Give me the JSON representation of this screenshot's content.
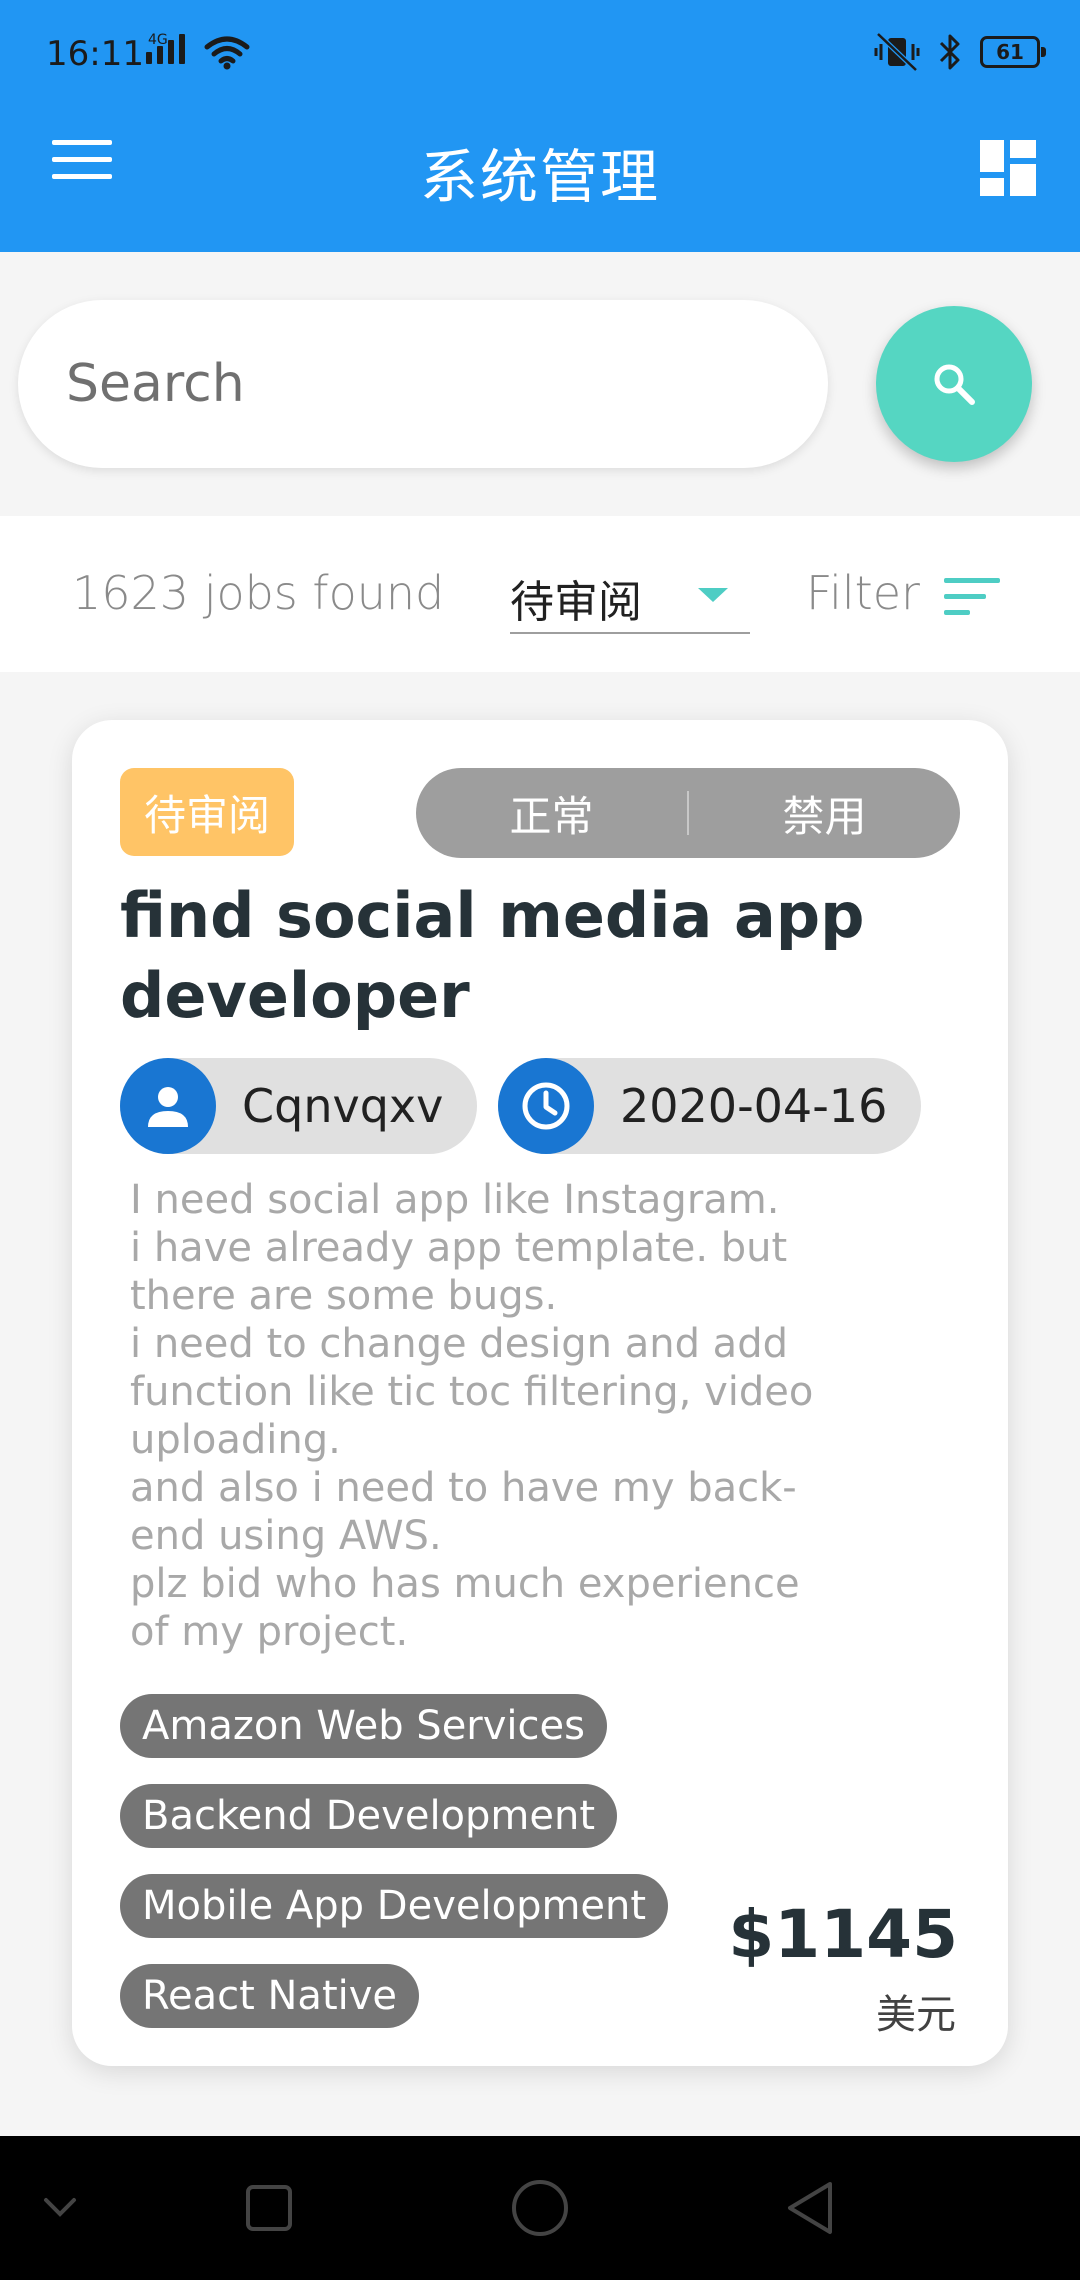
{
  "status_bar": {
    "time": "16:11",
    "network_label": "4G",
    "battery": "61"
  },
  "app_bar": {
    "title": "系统管理",
    "menu_icon": "hamburger-menu-icon",
    "dashboard_icon": "dashboard-icon"
  },
  "search": {
    "placeholder": "Search"
  },
  "filter_bar": {
    "jobs_count": "1623 jobs found",
    "status_selected": "待审阅",
    "filter_label": "Filter"
  },
  "job_card": {
    "status_badge": "待审阅",
    "toggle_options": [
      "正常",
      "禁用"
    ],
    "title": "find social media app developer",
    "author": "Cqnvqxv",
    "date": "2020-04-16",
    "description": "I need social app like Instagram.\ni have already app template. but\nthere are some bugs.\ni need to change design and add\nfunction like tic toc filtering, video\nuploading.\nand also i need to have my back-\nend using AWS.\nplz bid  who has much experience\nof my project.",
    "tags": [
      "Amazon Web Services",
      "Backend Development",
      "Mobile App Development",
      "React Native"
    ],
    "price": "$1145",
    "currency": "美元"
  },
  "colors": {
    "primary": "#2196f3",
    "accent": "#55d6c2",
    "badge_pending": "#ffc466",
    "avatar_blue": "#1976d2"
  }
}
